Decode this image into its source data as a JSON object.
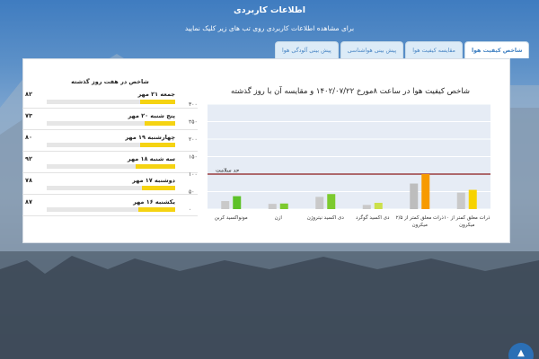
{
  "header": {
    "title": "اطلاعات کاربردی",
    "subtitle": "برای مشاهده اطلاعات کاربردی روی تب های زیر کلیک نمایید"
  },
  "tabs": [
    {
      "label": "شاخص کیفیت هوا",
      "active": true
    },
    {
      "label": "مقایسه کیفیت هوا",
      "active": false
    },
    {
      "label": "پیش بینی هواشناسی",
      "active": false
    },
    {
      "label": "پیش بینی آلودگی هوا",
      "active": false
    }
  ],
  "history": {
    "title": "شاخص در هفت روز گذشته",
    "items": [
      {
        "day": "جمعه ۲۱ مهر",
        "value": "۸۲",
        "level": 0.27
      },
      {
        "day": "پنج شنبه ۲۰ مهر",
        "value": "۷۳",
        "level": 0.24
      },
      {
        "day": "چهارشنبه ۱۹ مهر",
        "value": "۸۰",
        "level": 0.27
      },
      {
        "day": "سه شنبه ۱۸ مهر",
        "value": "۹۲",
        "level": 0.31
      },
      {
        "day": "دوشنبه ۱۷ مهر",
        "value": "۷۸",
        "level": 0.26
      },
      {
        "day": "یکشنبه ۱۶ مهر",
        "value": "۸۷",
        "level": 0.29
      }
    ]
  },
  "chart_data": {
    "type": "bar",
    "title": "شاخص کیفیت هوا در ساعت ۸مورخ ۱۴۰۲/۰۷/۲۲ و مقایسه آن با روز گذشته",
    "y_ticks": [
      "۰",
      "۵۰",
      "۱۰۰",
      "۱۵۰",
      "۲۰۰",
      "۲۵۰",
      "۳۰۰"
    ],
    "ylim": [
      0,
      300
    ],
    "threshold": {
      "label": "حد سلامت",
      "value": 100
    },
    "categories": [
      [
        "ذرات معلق کمتر از ۱۰",
        "میکرون"
      ],
      [
        "ذرات معلق کمتر از ۲/۵",
        "میکرون"
      ],
      [
        "دی اکسید گوگرد"
      ],
      [
        "دی اکسید نیتروژن"
      ],
      [
        "ازن"
      ],
      [
        "مونواکسید کربن"
      ]
    ],
    "series": [
      {
        "values": [
          47,
          73,
          12,
          35,
          15,
          23
        ]
      },
      {
        "values": [
          55,
          100,
          18,
          43,
          16,
          37
        ]
      }
    ],
    "colors": [
      [
        "#c9c9c9",
        "#f7d300"
      ],
      [
        "#bdbdbd",
        "#f79a00"
      ],
      [
        "#c9c9c9",
        "#cbe04a"
      ],
      [
        "#c9c9c9",
        "#7cca2e"
      ],
      [
        "#c9c9c9",
        "#7cca2e"
      ],
      [
        "#c9c9c9",
        "#5ec22a"
      ]
    ],
    "grid": true
  },
  "back_icon": "chevron-up-icon"
}
